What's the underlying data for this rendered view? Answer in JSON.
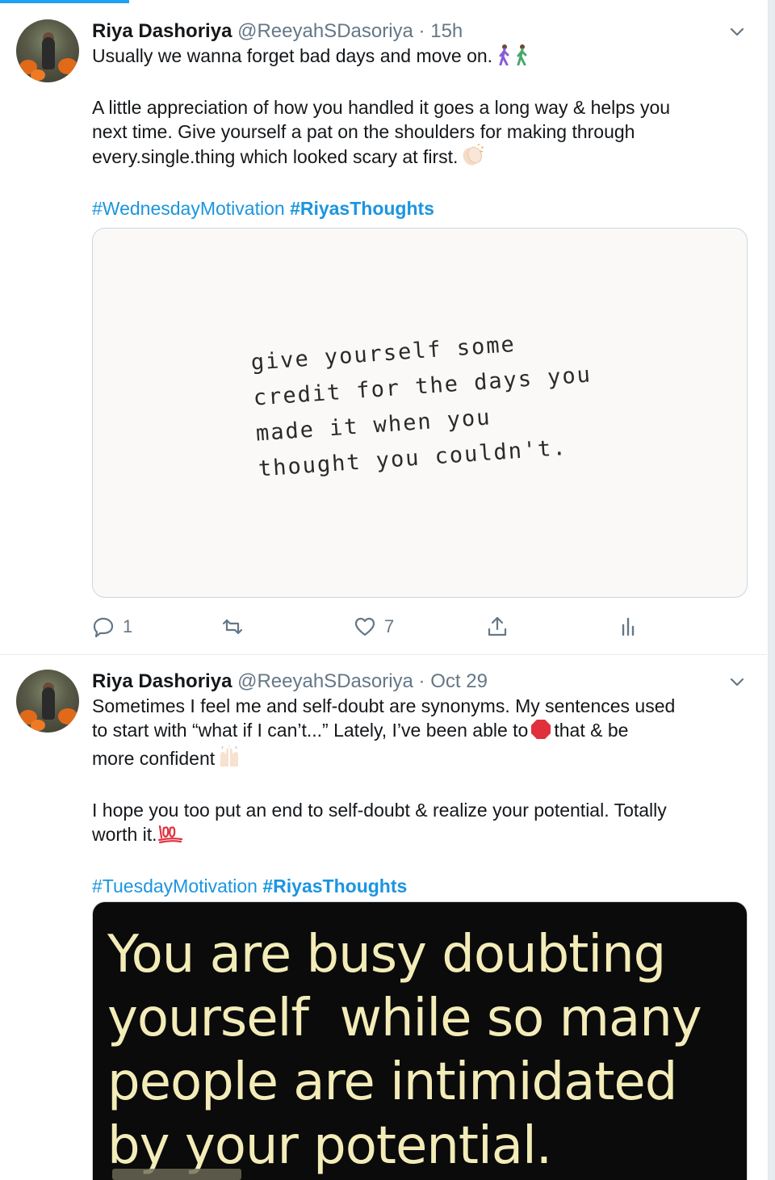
{
  "tweets": [
    {
      "name": "Riya Dashoriya",
      "handle": "@ReeyahSDasoriya",
      "time_sep": " · ",
      "time": "15h",
      "line1": "Usually we wanna forget bad days and move on.",
      "para2": "A little appreciation of how you handled it goes a long way & helps you\nnext time. Give yourself a pat on the shoulders for making through\nevery.single.thing which looked scary at first.",
      "hashtag1": "#WednesdayMotivation",
      "hashtag2": "#RiyasThoughts",
      "image_text": "give yourself some\ncredit for the days you\nmade it when you\nthought you couldn't.",
      "reply_count": "1",
      "retweet_count": "",
      "like_count": "7",
      "icons": [
        "walking-people-emoji",
        "clapping-hands-emoji",
        "reply-icon",
        "retweet-icon",
        "like-icon",
        "share-icon",
        "analytics-icon",
        "chevron-down-icon"
      ]
    },
    {
      "name": "Riya Dashoriya",
      "handle": "@ReeyahSDasoriya",
      "time_sep": " · ",
      "time": "Oct 29",
      "line1": "Sometimes I feel me and self-doubt are synonyms. My sentences used",
      "line2a": "to start with “what if I can’t...” Lately, I’ve been able to",
      "line2b": "that & be",
      "line3": "more confident",
      "para2a": "I hope you too put an end to self-doubt & realize your potential. Totally",
      "para2b": "worth it.",
      "hashtag1": "#TuesdayMotivation",
      "hashtag2": "#RiyasThoughts",
      "image_text": "You are busy doubting\nyourself  while so many\npeople are intimidated\nby your potential.",
      "icons": [
        "stop-sign-emoji",
        "raising-hands-emoji",
        "hundred-points-emoji",
        "chevron-down-icon"
      ]
    }
  ],
  "colors": {
    "link": "#1b95e0",
    "muted": "#657786",
    "text": "#14171a",
    "quote_text": "#f3ecb8",
    "quote_bg": "#0b0b0b"
  }
}
